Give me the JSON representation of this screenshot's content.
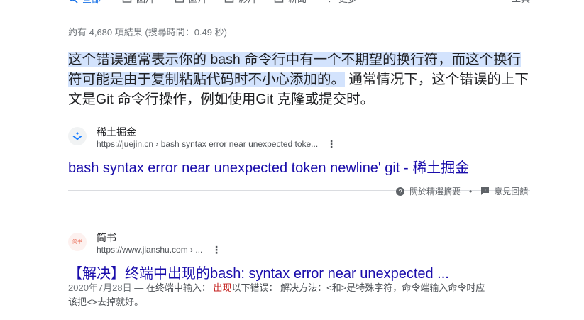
{
  "tabs": [
    {
      "label": "全部"
    },
    {
      "label": "圖片"
    },
    {
      "label": "圖片"
    },
    {
      "label": "影片"
    },
    {
      "label": "新聞"
    },
    {
      "label": "更多"
    }
  ],
  "tools_label": "工具",
  "stats": "約有 4,680 項結果 (搜尋時間：0.49 秒)",
  "featured": {
    "snippet_highlight": "这个错误通常表示你的 bash 命令行中有一个不期望的换行符，而这个换行符可能是由于复制粘贴代码时不小心添加的。",
    "snippet_rest": " 通常情况下，这个错误的上下文是Git 命令行操作，例如使用Git 克隆或提交时。",
    "site_name": "稀土掘金",
    "url": "https://juejin.cn › bash syntax error near unexpected toke...",
    "title": "bash syntax error near unexpected token newline' git - 稀土掘金"
  },
  "feedback": {
    "about_label": "關於精選摘要",
    "feedback_label": "意見回饋"
  },
  "result2": {
    "favicon_text": "简书",
    "site_name": "简书",
    "url": "https://www.jianshu.com › ...",
    "title": "【解决】终端中出现的bash: syntax error near unexpected ...",
    "date": "2020年7月28日",
    "desc_part1": " — 在终端中输入： ",
    "desc_em": "出现",
    "desc_part2": "以下错误： 解决方法：<和>是特殊字符，命令端输入命令时应该把<>去掉就好。"
  },
  "colors": {
    "link": "#1a0dab",
    "highlight": "#d3e3fd",
    "accent": "#1a73e8"
  }
}
